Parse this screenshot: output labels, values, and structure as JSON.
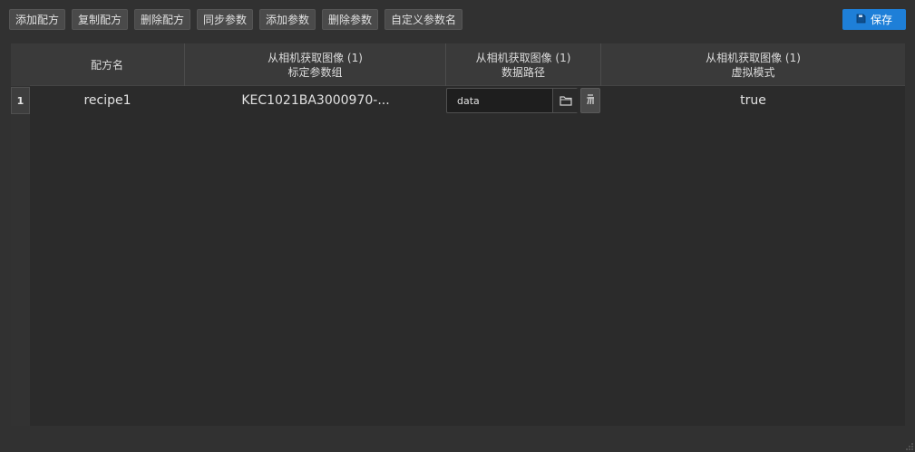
{
  "toolbar": {
    "buttons": [
      "添加配方",
      "复制配方",
      "删除配方",
      "同步参数",
      "添加参数",
      "删除参数",
      "自定义参数名"
    ],
    "save_label": "保存",
    "save_icon": "save-icon"
  },
  "table": {
    "columns": [
      {
        "line1": "配方名",
        "line2": ""
      },
      {
        "line1": "从相机获取图像 (1)",
        "line2": "标定参数组"
      },
      {
        "line1": "从相机获取图像 (1)",
        "line2": "数据路径"
      },
      {
        "line1": "从相机获取图像 (1)",
        "line2": "虚拟模式"
      }
    ],
    "rows": [
      {
        "index": "1",
        "recipe_name": "recipe1",
        "calib_group": "KEC1021BA3000970-...",
        "data_path": "data",
        "virtual_mode": "true"
      }
    ]
  },
  "colors": {
    "accent": "#1e7fd8",
    "background": "#313131",
    "table_bg": "#2b2b2b",
    "header_bg": "#3a3a3a"
  }
}
